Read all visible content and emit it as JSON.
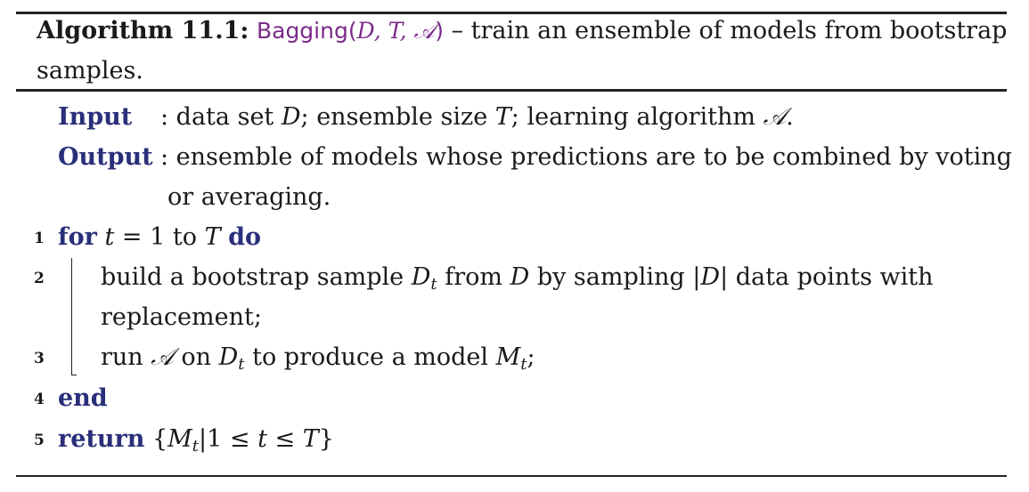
{
  "header": {
    "label": "Algorithm 11.1:",
    "name": "Bagging",
    "args": "D, T, 𝒜",
    "description_line1": "– train an ensemble of models from bootstrap",
    "description_line2": "samples."
  },
  "io": {
    "input_label": "Input",
    "input_text_1": ": data set ",
    "input_var_d": "D",
    "input_text_2": "; ensemble size ",
    "input_var_t": "T",
    "input_text_3": "; learning algorithm ",
    "input_var_a": "𝒜",
    "input_text_4": ".",
    "output_label": "Output",
    "output_text_1": ": ensemble of models whose predictions are to be combined by voting",
    "output_text_2": "or averaging."
  },
  "lines": [
    {
      "num": "1",
      "kw_for": "for",
      "var_t": "t",
      "eq": " = 1 to ",
      "var_T": "T",
      "kw_do": "do"
    },
    {
      "num": "2",
      "text_1": "build a bootstrap sample ",
      "var": "D",
      "sub": "t",
      "text_2": " from ",
      "var2": "D",
      "text_3": " by sampling |",
      "var3": "D",
      "text_4": "| data points with",
      "text_5": "replacement;"
    },
    {
      "num": "3",
      "text_1": "run ",
      "var": "𝒜",
      "text_2": " on ",
      "var2": "D",
      "sub": "t",
      "text_3": " to produce a model ",
      "var3": "M",
      "sub2": "t",
      "text_4": ";"
    },
    {
      "num": "4",
      "kw": "end"
    },
    {
      "num": "5",
      "kw": "return",
      "text_1": " {",
      "var": "M",
      "sub": "t",
      "text_2": "|1 ≤ ",
      "var2": "t",
      "text_3": " ≤ ",
      "var3": "T",
      "text_4": "}"
    }
  ]
}
